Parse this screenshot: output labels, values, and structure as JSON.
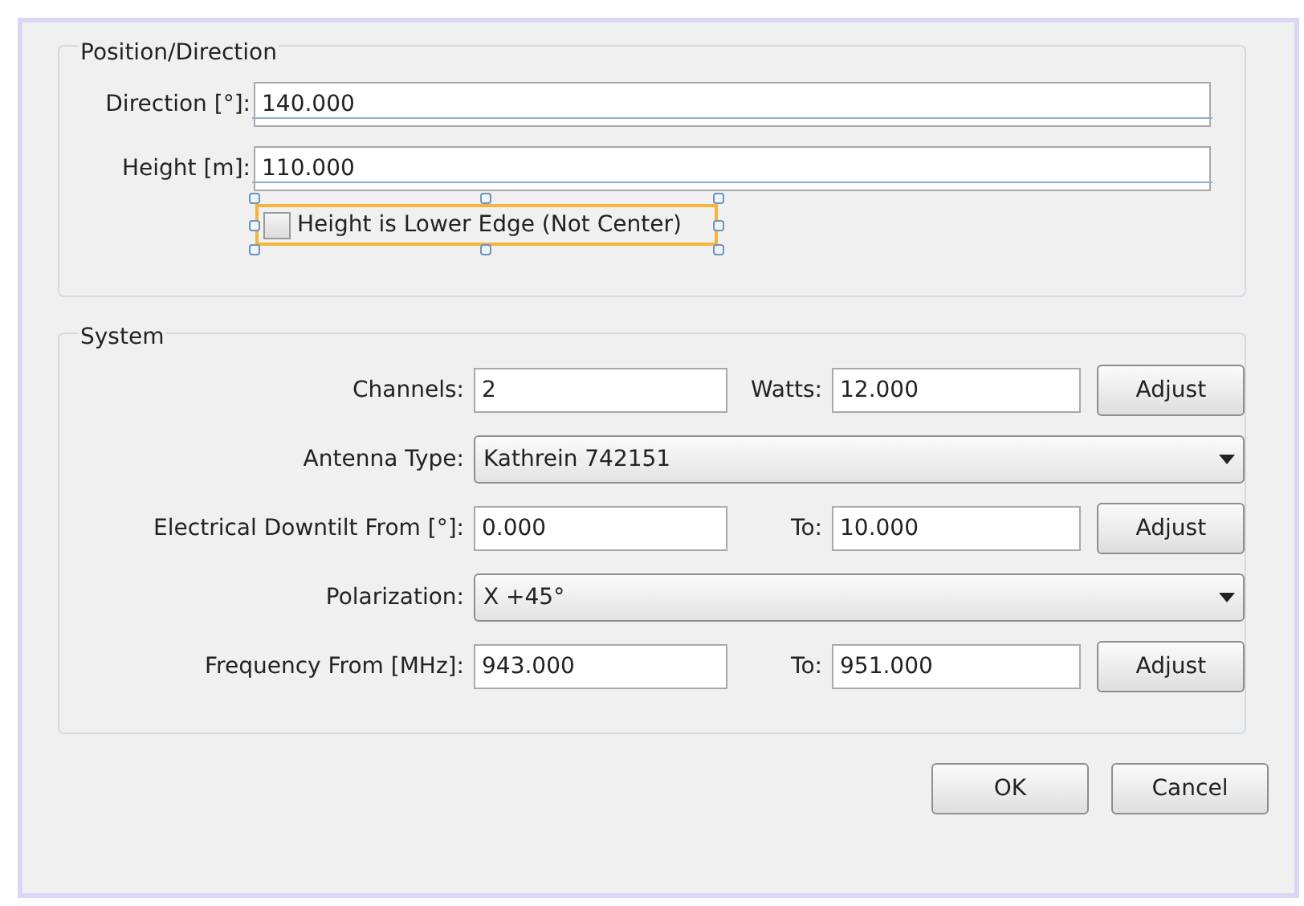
{
  "position": {
    "title": "Position/Direction",
    "fields": [
      {
        "label": "Direction [°]:",
        "value": "140.000"
      },
      {
        "label": "Height [m]:",
        "value": "110.000"
      }
    ],
    "checkbox": {
      "label": "Height is Lower Edge (Not Center)",
      "checked": false,
      "selected": true
    }
  },
  "system": {
    "title": "System",
    "rows": [
      {
        "kind": "pair",
        "label": "Channels:",
        "value": "2",
        "label2": "Watts:",
        "value2": "12.000",
        "button": "Adjust"
      },
      {
        "kind": "select",
        "label": "Antenna Type:",
        "value": "Kathrein 742151"
      },
      {
        "kind": "pair",
        "label": "Electrical Downtilt From [°]:",
        "value": "0.000",
        "label2": "To:",
        "value2": "10.000",
        "button": "Adjust"
      },
      {
        "kind": "select",
        "label": "Polarization:",
        "value": "X +45°"
      },
      {
        "kind": "pair",
        "label": "Frequency From [MHz]:",
        "value": "943.000",
        "label2": "To:",
        "value2": "951.000",
        "button": "Adjust"
      }
    ]
  },
  "buttons": [
    "OK",
    "Cancel"
  ]
}
